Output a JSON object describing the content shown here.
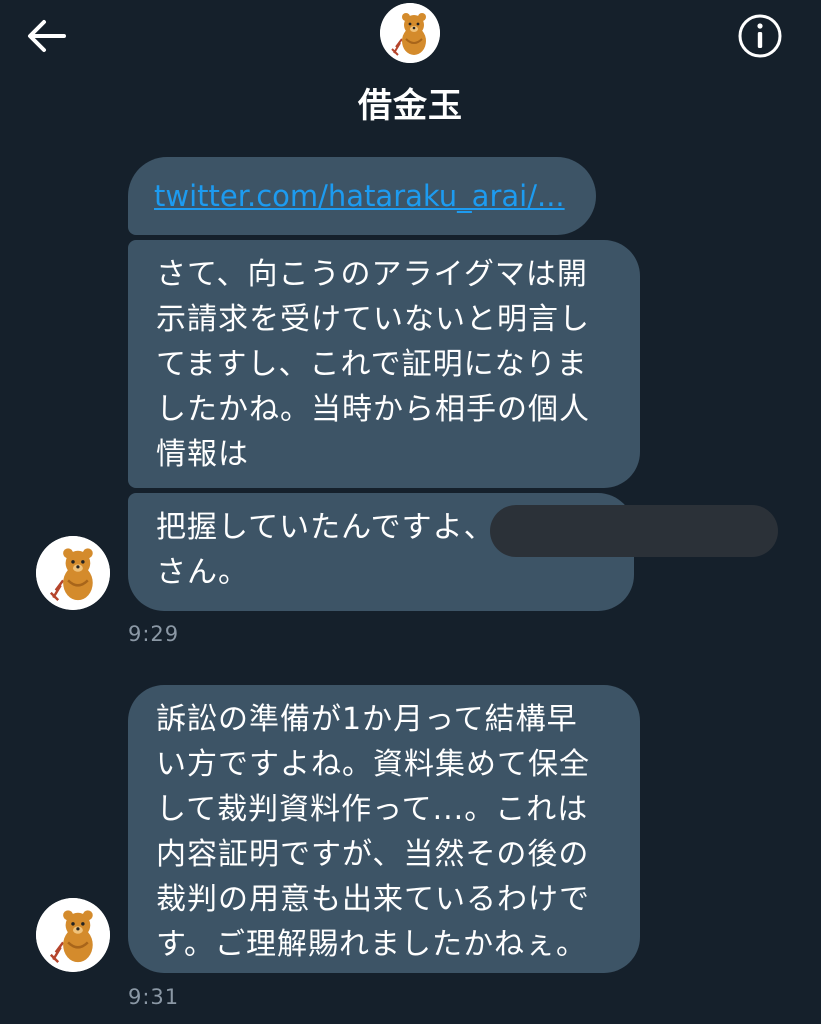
{
  "header": {
    "title": "借金玉",
    "back_icon": "arrow-left-icon",
    "info_icon": "info-icon",
    "avatar_icon": "bear-avatar-icon"
  },
  "messages": {
    "link": "twitter.com/hataraku_arai/...",
    "msg1": {
      "lines": [
        "さて、向こうのアライグマは開",
        "示請求を受けていないと明言し",
        "てますし、これで証明になりま",
        "したかね。当時から相手の個人",
        "情報は"
      ]
    },
    "msg2": {
      "lines": [
        "把握していたんですよ、",
        "さん。"
      ]
    },
    "timestamp1": "9:29",
    "msg3": {
      "lines": [
        "訴訟の準備が1か月って結構早",
        "い方ですよね。資料集めて保全",
        "して裁判資料作って...。これは",
        "内容証明ですが、当然その後の",
        "裁判の用意も出来ているわけで",
        "す。ご理解賜れましたかねぇ。"
      ]
    },
    "timestamp2": "9:31"
  },
  "colors": {
    "background": "#15202b",
    "bubble": "#3d5466",
    "link": "#1d9bf0",
    "timestamp": "#8b98a5",
    "redaction": "#2b3138"
  }
}
